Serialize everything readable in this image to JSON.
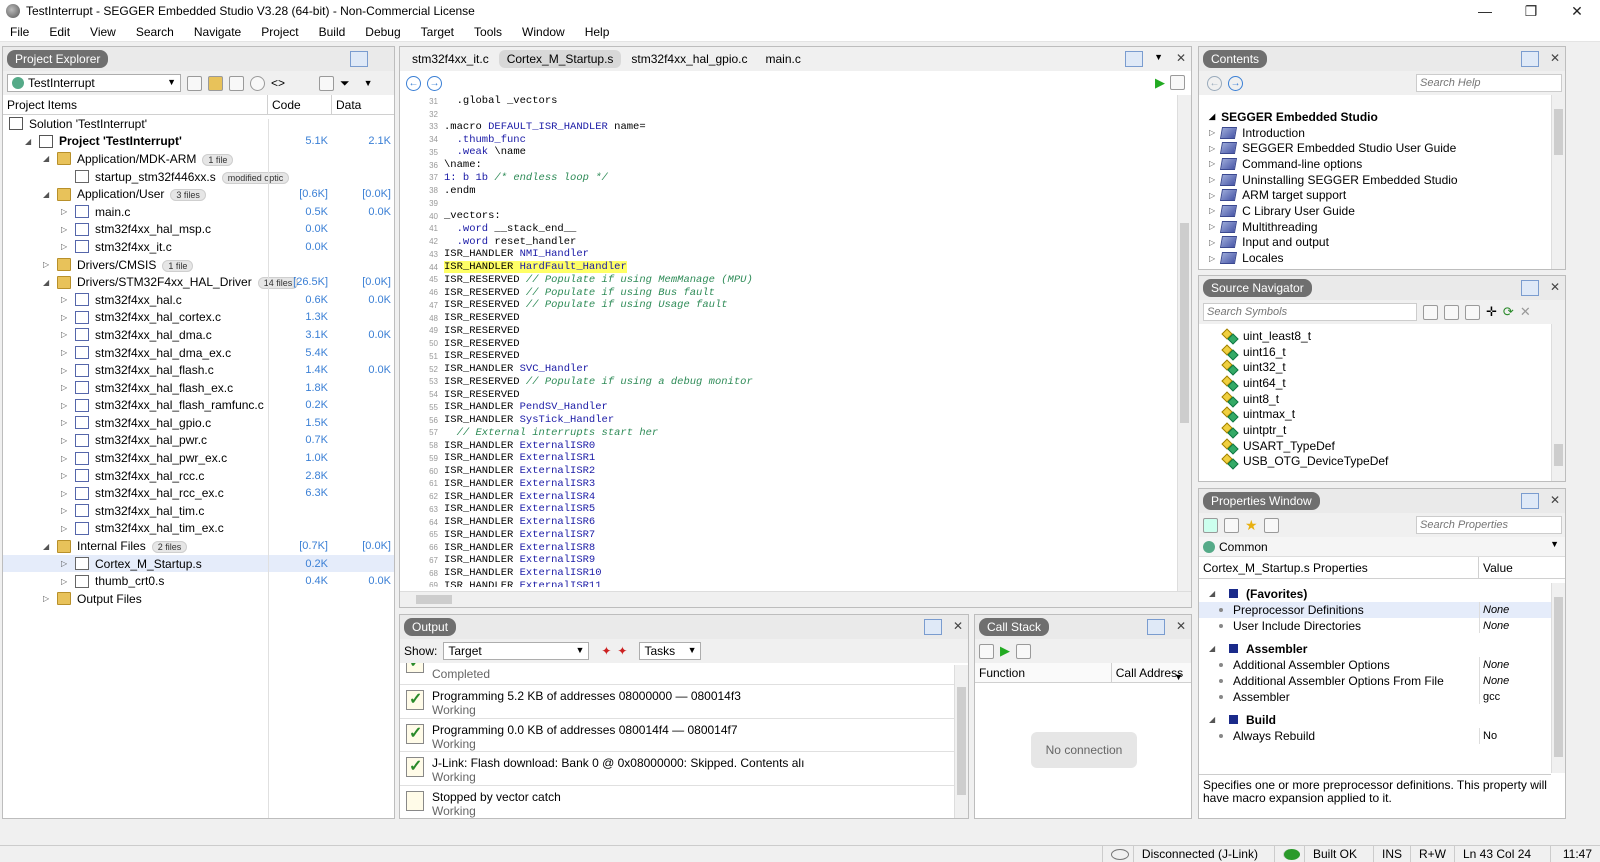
{
  "window": {
    "title": "TestInterrupt - SEGGER Embedded Studio V3.28 (64-bit) - Non-Commercial License",
    "minimize": "—",
    "maximize": "❐",
    "close": "✕"
  },
  "menu": [
    "File",
    "Edit",
    "View",
    "Search",
    "Navigate",
    "Project",
    "Build",
    "Debug",
    "Target",
    "Tools",
    "Window",
    "Help"
  ],
  "project_explorer": {
    "title": "Project Explorer",
    "project_combo": "TestInterrupt",
    "columns": {
      "items": "Project Items",
      "code": "Code",
      "data": "Data"
    },
    "rows": [
      {
        "label": "Solution 'TestInterrupt'",
        "icon": "solution-icon",
        "indent": 0,
        "twisty": "",
        "badge": "",
        "code": "",
        "data": ""
      },
      {
        "label": "Project 'TestInterrupt'",
        "icon": "project-icon",
        "indent": 1,
        "twisty": "◢",
        "badge": "",
        "code": "5.1K",
        "data": "2.1K",
        "bold": true
      },
      {
        "label": "Application/MDK-ARM",
        "icon": "folder-icon",
        "indent": 2,
        "twisty": "◢",
        "badge": "1 file",
        "code": "",
        "data": ""
      },
      {
        "label": "startup_stm32f446xx.s",
        "icon": "asm-file-icon",
        "indent": 3,
        "twisty": "",
        "badge": "modified optic",
        "code": "",
        "data": ""
      },
      {
        "label": "Application/User",
        "icon": "folder-icon",
        "indent": 2,
        "twisty": "◢",
        "badge": "3 files",
        "code": "[0.6K]",
        "data": "[0.0K]"
      },
      {
        "label": "main.c",
        "icon": "c-file-icon",
        "indent": 3,
        "twisty": "▷",
        "badge": "",
        "code": "0.5K",
        "data": "0.0K"
      },
      {
        "label": "stm32f4xx_hal_msp.c",
        "icon": "c-file-icon",
        "indent": 3,
        "twisty": "▷",
        "badge": "",
        "code": "0.0K",
        "data": ""
      },
      {
        "label": "stm32f4xx_it.c",
        "icon": "c-file-icon",
        "indent": 3,
        "twisty": "▷",
        "badge": "",
        "code": "0.0K",
        "data": ""
      },
      {
        "label": "Drivers/CMSIS",
        "icon": "folder-icon",
        "indent": 2,
        "twisty": "▷",
        "badge": "1 file",
        "code": "",
        "data": ""
      },
      {
        "label": "Drivers/STM32F4xx_HAL_Driver",
        "icon": "folder-icon",
        "indent": 2,
        "twisty": "◢",
        "badge": "14 files",
        "code": "[26.5K]",
        "data": "[0.0K]"
      },
      {
        "label": "stm32f4xx_hal.c",
        "icon": "c-file-icon",
        "indent": 3,
        "twisty": "▷",
        "badge": "",
        "code": "0.6K",
        "data": "0.0K"
      },
      {
        "label": "stm32f4xx_hal_cortex.c",
        "icon": "c-file-icon",
        "indent": 3,
        "twisty": "▷",
        "badge": "",
        "code": "1.3K",
        "data": ""
      },
      {
        "label": "stm32f4xx_hal_dma.c",
        "icon": "c-file-icon",
        "indent": 3,
        "twisty": "▷",
        "badge": "",
        "code": "3.1K",
        "data": "0.0K"
      },
      {
        "label": "stm32f4xx_hal_dma_ex.c",
        "icon": "c-file-icon",
        "indent": 3,
        "twisty": "▷",
        "badge": "",
        "code": "5.4K",
        "data": ""
      },
      {
        "label": "stm32f4xx_hal_flash.c",
        "icon": "c-file-icon",
        "indent": 3,
        "twisty": "▷",
        "badge": "",
        "code": "1.4K",
        "data": "0.0K"
      },
      {
        "label": "stm32f4xx_hal_flash_ex.c",
        "icon": "c-file-icon",
        "indent": 3,
        "twisty": "▷",
        "badge": "",
        "code": "1.8K",
        "data": ""
      },
      {
        "label": "stm32f4xx_hal_flash_ramfunc.c",
        "icon": "c-file-icon",
        "indent": 3,
        "twisty": "▷",
        "badge": "",
        "code": "0.2K",
        "data": ""
      },
      {
        "label": "stm32f4xx_hal_gpio.c",
        "icon": "c-file-icon",
        "indent": 3,
        "twisty": "▷",
        "badge": "",
        "code": "1.5K",
        "data": ""
      },
      {
        "label": "stm32f4xx_hal_pwr.c",
        "icon": "c-file-icon",
        "indent": 3,
        "twisty": "▷",
        "badge": "",
        "code": "0.7K",
        "data": ""
      },
      {
        "label": "stm32f4xx_hal_pwr_ex.c",
        "icon": "c-file-icon",
        "indent": 3,
        "twisty": "▷",
        "badge": "",
        "code": "1.0K",
        "data": ""
      },
      {
        "label": "stm32f4xx_hal_rcc.c",
        "icon": "c-file-icon",
        "indent": 3,
        "twisty": "▷",
        "badge": "",
        "code": "2.8K",
        "data": ""
      },
      {
        "label": "stm32f4xx_hal_rcc_ex.c",
        "icon": "c-file-icon",
        "indent": 3,
        "twisty": "▷",
        "badge": "",
        "code": "6.3K",
        "data": ""
      },
      {
        "label": "stm32f4xx_hal_tim.c",
        "icon": "c-file-icon",
        "indent": 3,
        "twisty": "▷",
        "badge": "",
        "code": "",
        "data": ""
      },
      {
        "label": "stm32f4xx_hal_tim_ex.c",
        "icon": "c-file-icon",
        "indent": 3,
        "twisty": "▷",
        "badge": "",
        "code": "",
        "data": ""
      },
      {
        "label": "Internal Files",
        "icon": "folder-icon",
        "indent": 2,
        "twisty": "◢",
        "badge": "2 files",
        "code": "[0.7K]",
        "data": "[0.0K]"
      },
      {
        "label": "Cortex_M_Startup.s",
        "icon": "asm-file-icon",
        "indent": 3,
        "twisty": "▷",
        "badge": "",
        "code": "0.2K",
        "data": "",
        "selected": true
      },
      {
        "label": "thumb_crt0.s",
        "icon": "asm-file-icon",
        "indent": 3,
        "twisty": "▷",
        "badge": "",
        "code": "0.4K",
        "data": "0.0K"
      },
      {
        "label": "Output Files",
        "icon": "folder-icon",
        "indent": 2,
        "twisty": "▷",
        "badge": "",
        "code": "",
        "data": ""
      }
    ]
  },
  "editor": {
    "tabs": [
      {
        "label": "stm32f4xx_it.c",
        "active": false
      },
      {
        "label": "Cortex_M_Startup.s",
        "active": true
      },
      {
        "label": "stm32f4xx_hal_gpio.c",
        "active": false
      },
      {
        "label": "main.c",
        "active": false
      }
    ],
    "lines": [
      {
        "n": "31",
        "segs": [
          {
            "t": "  .global _vectors",
            "c": ""
          }
        ]
      },
      {
        "n": "32",
        "segs": [
          {
            "t": "",
            "c": ""
          }
        ]
      },
      {
        "n": "33",
        "segs": [
          {
            "t": ".macro ",
            "c": ""
          },
          {
            "t": "DEFAULT_ISR_HANDLER",
            "c": "kw"
          },
          {
            "t": " name=",
            "c": ""
          }
        ]
      },
      {
        "n": "34",
        "segs": [
          {
            "t": "  .thumb_func",
            "c": "kw"
          }
        ]
      },
      {
        "n": "35",
        "segs": [
          {
            "t": "  .weak ",
            "c": "kw"
          },
          {
            "t": "\\name",
            "c": ""
          }
        ]
      },
      {
        "n": "36",
        "segs": [
          {
            "t": "\\name:",
            "c": ""
          }
        ]
      },
      {
        "n": "37",
        "segs": [
          {
            "t": "1: ",
            "c": "kw"
          },
          {
            "t": "b 1b ",
            "c": "kw"
          },
          {
            "t": "/* endless loop */",
            "c": "cm"
          }
        ]
      },
      {
        "n": "38",
        "segs": [
          {
            "t": ".endm",
            "c": ""
          }
        ]
      },
      {
        "n": "39",
        "segs": [
          {
            "t": "",
            "c": ""
          }
        ]
      },
      {
        "n": "40",
        "segs": [
          {
            "t": "_vectors:",
            "c": ""
          }
        ]
      },
      {
        "n": "41",
        "segs": [
          {
            "t": "  .word ",
            "c": "kw"
          },
          {
            "t": "__stack_end__",
            "c": ""
          }
        ]
      },
      {
        "n": "42",
        "segs": [
          {
            "t": "  .word ",
            "c": "kw"
          },
          {
            "t": "reset_handler",
            "c": ""
          }
        ]
      },
      {
        "n": "43",
        "segs": [
          {
            "t": "ISR_HANDLER ",
            "c": ""
          },
          {
            "t": "NMI_Handler",
            "c": "kw"
          }
        ]
      },
      {
        "n": "44",
        "hl": true,
        "segs": [
          {
            "t": "ISR_HANDLER ",
            "c": ""
          },
          {
            "t": "HardFault_Handler",
            "c": "kw"
          }
        ]
      },
      {
        "n": "45",
        "segs": [
          {
            "t": "ISR_RESERVED ",
            "c": ""
          },
          {
            "t": "// Populate if using MemManage (MPU)",
            "c": "cm"
          }
        ]
      },
      {
        "n": "46",
        "segs": [
          {
            "t": "ISR_RESERVED ",
            "c": ""
          },
          {
            "t": "// Populate if using Bus fault",
            "c": "cm"
          }
        ]
      },
      {
        "n": "47",
        "segs": [
          {
            "t": "ISR_RESERVED ",
            "c": ""
          },
          {
            "t": "// Populate if using Usage fault",
            "c": "cm"
          }
        ]
      },
      {
        "n": "48",
        "segs": [
          {
            "t": "ISR_RESERVED",
            "c": ""
          }
        ]
      },
      {
        "n": "49",
        "segs": [
          {
            "t": "ISR_RESERVED",
            "c": ""
          }
        ]
      },
      {
        "n": "50",
        "segs": [
          {
            "t": "ISR_RESERVED",
            "c": ""
          }
        ]
      },
      {
        "n": "51",
        "segs": [
          {
            "t": "ISR_RESERVED",
            "c": ""
          }
        ]
      },
      {
        "n": "52",
        "segs": [
          {
            "t": "ISR_HANDLER ",
            "c": ""
          },
          {
            "t": "SVC_Handler",
            "c": "kw"
          }
        ]
      },
      {
        "n": "53",
        "segs": [
          {
            "t": "ISR_RESERVED ",
            "c": ""
          },
          {
            "t": "// Populate if using a debug monitor",
            "c": "cm"
          }
        ]
      },
      {
        "n": "54",
        "segs": [
          {
            "t": "ISR_RESERVED",
            "c": ""
          }
        ]
      },
      {
        "n": "55",
        "segs": [
          {
            "t": "ISR_HANDLER ",
            "c": ""
          },
          {
            "t": "PendSV_Handler",
            "c": "kw"
          }
        ]
      },
      {
        "n": "56",
        "segs": [
          {
            "t": "ISR_HANDLER ",
            "c": ""
          },
          {
            "t": "SysTick_Handler",
            "c": "kw"
          }
        ]
      },
      {
        "n": "57",
        "segs": [
          {
            "t": "  // External interrupts start her",
            "c": "cm"
          }
        ]
      },
      {
        "n": "58",
        "segs": [
          {
            "t": "ISR_HANDLER ",
            "c": ""
          },
          {
            "t": "ExternalISR0",
            "c": "kw"
          }
        ]
      },
      {
        "n": "59",
        "segs": [
          {
            "t": "ISR_HANDLER ",
            "c": ""
          },
          {
            "t": "ExternalISR1",
            "c": "kw"
          }
        ]
      },
      {
        "n": "60",
        "segs": [
          {
            "t": "ISR_HANDLER ",
            "c": ""
          },
          {
            "t": "ExternalISR2",
            "c": "kw"
          }
        ]
      },
      {
        "n": "61",
        "segs": [
          {
            "t": "ISR_HANDLER ",
            "c": ""
          },
          {
            "t": "ExternalISR3",
            "c": "kw"
          }
        ]
      },
      {
        "n": "62",
        "segs": [
          {
            "t": "ISR_HANDLER ",
            "c": ""
          },
          {
            "t": "ExternalISR4",
            "c": "kw"
          }
        ]
      },
      {
        "n": "63",
        "segs": [
          {
            "t": "ISR_HANDLER ",
            "c": ""
          },
          {
            "t": "ExternalISR5",
            "c": "kw"
          }
        ]
      },
      {
        "n": "64",
        "segs": [
          {
            "t": "ISR_HANDLER ",
            "c": ""
          },
          {
            "t": "ExternalISR6",
            "c": "kw"
          }
        ]
      },
      {
        "n": "65",
        "segs": [
          {
            "t": "ISR_HANDLER ",
            "c": ""
          },
          {
            "t": "ExternalISR7",
            "c": "kw"
          }
        ]
      },
      {
        "n": "66",
        "segs": [
          {
            "t": "ISR_HANDLER ",
            "c": ""
          },
          {
            "t": "ExternalISR8",
            "c": "kw"
          }
        ]
      },
      {
        "n": "67",
        "segs": [
          {
            "t": "ISR_HANDLER ",
            "c": ""
          },
          {
            "t": "ExternalISR9",
            "c": "kw"
          }
        ]
      },
      {
        "n": "68",
        "segs": [
          {
            "t": "ISR_HANDLER ",
            "c": ""
          },
          {
            "t": "ExternalISR10",
            "c": "kw"
          }
        ]
      },
      {
        "n": "69",
        "segs": [
          {
            "t": "ISR_HANDLER ",
            "c": ""
          },
          {
            "t": "ExternalISR11",
            "c": "kw"
          }
        ]
      }
    ]
  },
  "contents": {
    "title": "Contents",
    "search_placeholder": "Search Help",
    "root": "SEGGER Embedded Studio",
    "items": [
      "Introduction",
      "SEGGER Embedded Studio User Guide",
      "Command-line options",
      "Uninstalling SEGGER Embedded Studio",
      "ARM target support",
      "C Library User Guide",
      "Multithreading",
      "Input and output",
      "Locales"
    ]
  },
  "source_navigator": {
    "title": "Source Navigator",
    "search_placeholder": "Search Symbols",
    "items": [
      "uint_least8_t",
      "uint16_t",
      "uint32_t",
      "uint64_t",
      "uint8_t",
      "uintmax_t",
      "uintptr_t",
      "USART_TypeDef",
      "USB_OTG_DeviceTypeDef"
    ]
  },
  "properties": {
    "title": "Properties Window",
    "search_placeholder": "Search Properties",
    "filter": "Common",
    "col_name": "Cortex_M_Startup.s Properties",
    "col_value": "Value",
    "groups": [
      {
        "name": "(Favorites)",
        "props": [
          {
            "n": "Preprocessor Definitions",
            "v": "None"
          },
          {
            "n": "User Include Directories",
            "v": "None"
          }
        ]
      },
      {
        "name": "Assembler",
        "props": [
          {
            "n": "Additional Assembler Options",
            "v": "None"
          },
          {
            "n": "Additional Assembler Options From File",
            "v": "None"
          },
          {
            "n": "Assembler",
            "v": "gcc"
          }
        ]
      },
      {
        "name": "Build",
        "props": [
          {
            "n": "Always Rebuild",
            "v": "No"
          }
        ]
      }
    ],
    "description": "Specifies one or more preprocessor definitions. This property will have macro expansion applied to it."
  },
  "output": {
    "title": "Output",
    "show_label": "Show:",
    "show_value": "Target",
    "tasks_value": "Tasks",
    "rows": [
      {
        "t1": "Programming 5.2 KB of addresses 08000000 — 080014f3",
        "t2": "Working"
      },
      {
        "t1": "Programming 0.0 KB of addresses 080014f4 — 080014f7",
        "t2": "Working"
      },
      {
        "t1": "J-Link: Flash download: Bank 0 @ 0x08000000: Skipped. Contents alı",
        "t2": "Working"
      },
      {
        "t1": "Stopped by vector catch",
        "t2": "Working"
      }
    ],
    "first_partial": "Completed"
  },
  "callstack": {
    "title": "Call Stack",
    "col_function": "Function",
    "col_address": "Call Address",
    "empty": "No connection"
  },
  "status": {
    "connection": "Disconnected (J-Link)",
    "build": "Built OK",
    "mode": "INS",
    "rw": "R+W",
    "position": "Ln 43 Col 24",
    "time": "11:47"
  },
  "colors": {
    "accent": "#3a7fd5",
    "highlight": "#ffff66",
    "keyword": "#1a1aa6",
    "comment": "#2e8b57"
  }
}
